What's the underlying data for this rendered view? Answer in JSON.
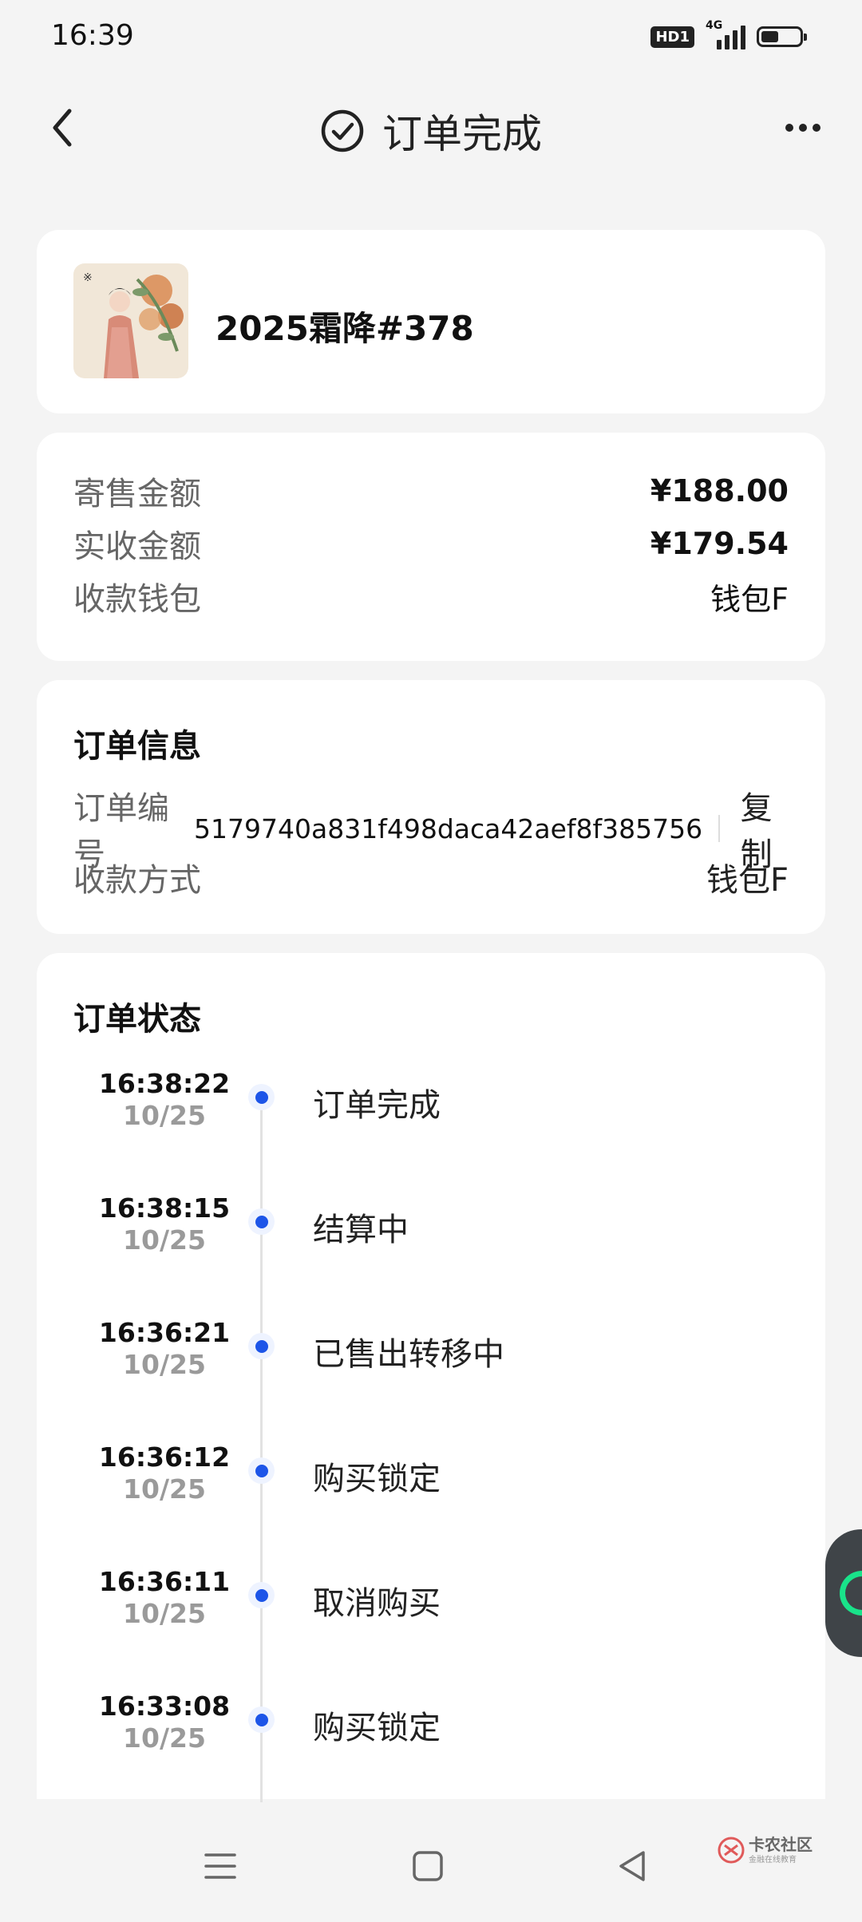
{
  "status_bar": {
    "time": "16:39",
    "hd_badge": "HD1",
    "network": "4G",
    "battery_level": 0.45
  },
  "header": {
    "title": "订单完成",
    "back_icon": "chevron-left-icon",
    "title_icon": "check-circle-icon",
    "more_icon": "more-horizontal-icon"
  },
  "product": {
    "name": "2025霜降#378"
  },
  "amounts": {
    "rows": [
      {
        "label": "寄售金额",
        "value": "¥188.00"
      },
      {
        "label": "实收金额",
        "value": "¥179.54"
      },
      {
        "label": "收款钱包",
        "value": "钱包F"
      }
    ]
  },
  "order_info": {
    "title": "订单信息",
    "number_label": "订单编号",
    "number": "5179740a831f498daca42aef8f385756",
    "copy_label": "复制",
    "payment_label": "收款方式",
    "payment_value": "钱包F"
  },
  "order_status": {
    "title": "订单状态",
    "items": [
      {
        "time": "16:38:22",
        "date": "10/25",
        "text": "订单完成"
      },
      {
        "time": "16:38:15",
        "date": "10/25",
        "text": "结算中"
      },
      {
        "time": "16:36:21",
        "date": "10/25",
        "text": "已售出转移中"
      },
      {
        "time": "16:36:12",
        "date": "10/25",
        "text": "购买锁定"
      },
      {
        "time": "16:36:11",
        "date": "10/25",
        "text": "取消购买"
      },
      {
        "time": "16:33:08",
        "date": "10/25",
        "text": "购买锁定"
      }
    ]
  },
  "nav": {
    "menu_icon": "menu-icon",
    "home_icon": "square-home-icon",
    "back_icon": "triangle-back-icon"
  },
  "watermark": {
    "text": "卡农社区",
    "sub": "金融在线教育"
  },
  "colors": {
    "accent": "#1d55e8",
    "background": "#f4f4f4",
    "card": "#ffffff"
  }
}
